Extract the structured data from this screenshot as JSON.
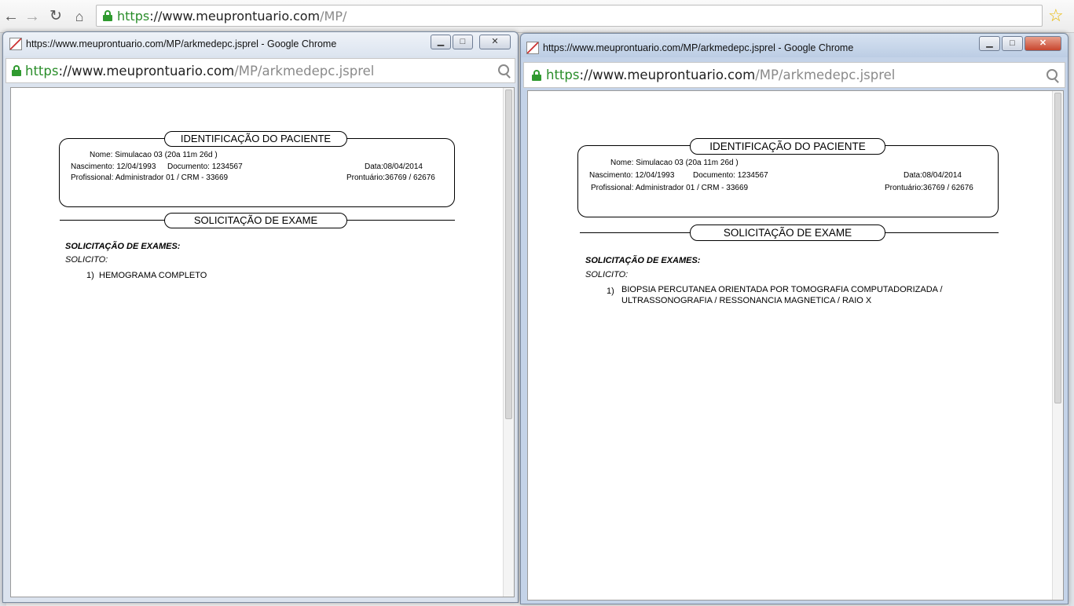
{
  "main_window": {
    "url_scheme": "https",
    "url_host": "://www.meuprontuario.com",
    "url_path": "/MP/"
  },
  "left_popup": {
    "title": "https://www.meuprontuario.com/MP/arkmedepc.jsprel - Google Chrome",
    "url_scheme": "https",
    "url_host": "://www.meuprontuario.com",
    "url_path": "/MP/arkmedepc.jsprel",
    "report": {
      "id_title": "IDENTIFICAÇÃO DO PACIENTE",
      "nome": "Nome: Simulacao 03 (20a 11m 26d )",
      "nascimento": "Nascimento: 12/04/1993",
      "documento": "Documento: 1234567",
      "data": "Data:08/04/2014",
      "profissional": "Profissional: Administrador 01 / CRM - 33669",
      "prontuario": "Prontuário:36769 / 62676",
      "section_title": "SOLICITAÇÃO DE EXAME",
      "exams_heading": "SOLICITAÇÃO DE EXAMES:",
      "solicito": "SOLICITO:",
      "items": [
        {
          "num": "1)",
          "text": "HEMOGRAMA COMPLETO"
        }
      ]
    }
  },
  "right_popup": {
    "title": "https://www.meuprontuario.com/MP/arkmedepc.jsprel - Google Chrome",
    "url_scheme": "https",
    "url_host": "://www.meuprontuario.com",
    "url_path": "/MP/arkmedepc.jsprel",
    "report": {
      "id_title": "IDENTIFICAÇÃO DO PACIENTE",
      "nome": "Nome: Simulacao 03 (20a 11m 26d )",
      "nascimento": "Nascimento: 12/04/1993",
      "documento": "Documento: 1234567",
      "data": "Data:08/04/2014",
      "profissional": "Profissional: Administrador 01 / CRM - 33669",
      "prontuario": "Prontuário:36769 / 62676",
      "section_title": "SOLICITAÇÃO DE EXAME",
      "exams_heading": "SOLICITAÇÃO DE EXAMES:",
      "solicito": "SOLICITO:",
      "items": [
        {
          "num": "1)",
          "text": "BIOPSIA PERCUTANEA ORIENTADA POR TOMOGRAFIA COMPUTADORIZADA / ULTRASSONOGRAFIA / RESSONANCIA MAGNETICA / RAIO X"
        }
      ]
    }
  },
  "colors": {
    "secure_green": "#2a8d2a",
    "titlebar_left": "#e9eef5",
    "titlebar_right": "#c9d7ea"
  }
}
